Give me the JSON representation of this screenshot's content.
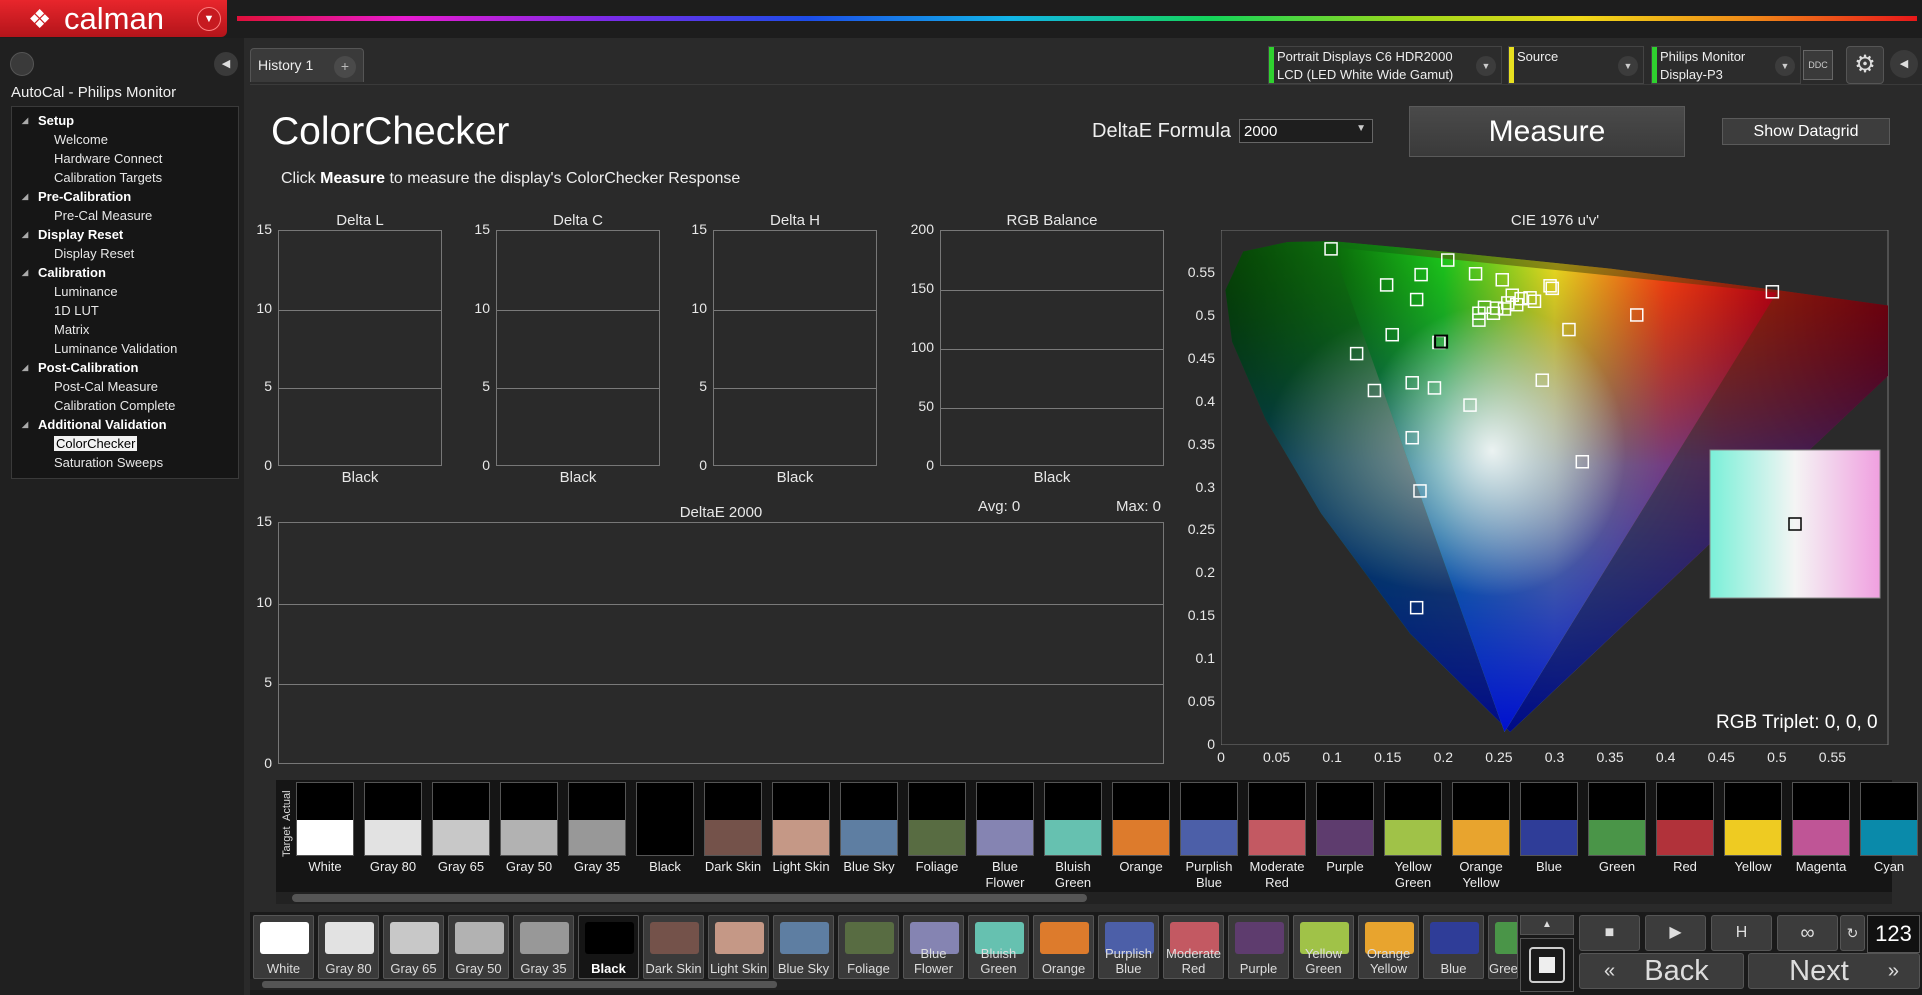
{
  "app": {
    "name": "calman",
    "tab": "History 1",
    "tab_add": "+"
  },
  "devices": {
    "display": {
      "line1": "Portrait Displays C6 HDR2000",
      "line2": "LCD (LED White Wide Gamut)",
      "color": "#2fd22f"
    },
    "source": {
      "line1": "Source",
      "line2": "",
      "color": "#e8e020"
    },
    "monitor": {
      "line1": "Philips Monitor",
      "line2": "Display-P3",
      "color": "#2fd22f"
    },
    "ddc": "DDC"
  },
  "sidebar": {
    "title": "AutoCal - Philips Monitor",
    "sections": [
      {
        "label": "Setup",
        "items": [
          "Welcome",
          "Hardware Connect",
          "Calibration Targets"
        ]
      },
      {
        "label": "Pre-Calibration",
        "items": [
          "Pre-Cal Measure"
        ]
      },
      {
        "label": "Display Reset",
        "items": [
          "Display Reset"
        ]
      },
      {
        "label": "Calibration",
        "items": [
          "Luminance",
          "1D LUT",
          "Matrix",
          "Luminance Validation"
        ]
      },
      {
        "label": "Post-Calibration",
        "items": [
          "Post-Cal Measure",
          "Calibration Complete"
        ]
      },
      {
        "label": "Additional Validation",
        "items": [
          "ColorChecker",
          "Saturation Sweeps"
        ]
      }
    ],
    "selected": "ColorChecker"
  },
  "page": {
    "title": "ColorChecker",
    "subtitle_pre": "Click ",
    "subtitle_bold": "Measure",
    "subtitle_post": " to measure the display's ColorChecker Response",
    "deltae_label": "DeltaE Formula",
    "deltae_value": "2000",
    "measure_button": "Measure",
    "datagrid_button": "Show Datagrid",
    "rgb_triplet": "RGB Triplet: 0, 0, 0"
  },
  "chart_data": [
    {
      "type": "bar",
      "title": "Delta L",
      "categories": [
        "Black"
      ],
      "values": [
        0
      ],
      "ylim": [
        0,
        15
      ],
      "yticks": [
        0,
        5,
        10,
        15
      ]
    },
    {
      "type": "bar",
      "title": "Delta C",
      "categories": [
        "Black"
      ],
      "values": [
        0
      ],
      "ylim": [
        0,
        15
      ],
      "yticks": [
        0,
        5,
        10,
        15
      ]
    },
    {
      "type": "bar",
      "title": "Delta H",
      "categories": [
        "Black"
      ],
      "values": [
        0
      ],
      "ylim": [
        0,
        15
      ],
      "yticks": [
        0,
        5,
        10,
        15
      ]
    },
    {
      "type": "bar",
      "title": "RGB Balance",
      "categories": [
        "Black"
      ],
      "values": [
        0
      ],
      "ylim": [
        0,
        200
      ],
      "yticks": [
        0,
        50,
        100,
        150,
        200
      ]
    },
    {
      "type": "bar",
      "title": "DeltaE 2000",
      "avg": "Avg: 0",
      "max": "Max: 0",
      "values": [],
      "ylim": [
        0,
        15
      ],
      "yticks": [
        0,
        5,
        10,
        15
      ]
    },
    {
      "type": "scatter",
      "title": "CIE 1976 u'v'",
      "xlim": [
        0,
        0.6
      ],
      "ylim": [
        0,
        0.6
      ],
      "xticks": [
        "0",
        "0.05",
        "0.1",
        "0.15",
        "0.2",
        "0.25",
        "0.3",
        "0.35",
        "0.4",
        "0.45",
        "0.5",
        "0.55"
      ],
      "yticks": [
        "0",
        "0.05",
        "0.1",
        "0.15",
        "0.2",
        "0.25",
        "0.3",
        "0.35",
        "0.4",
        "0.45",
        "0.5",
        "0.55"
      ],
      "gamut_triangle": [
        [
          0.1,
          0.58
        ],
        [
          0.5,
          0.527
        ],
        [
          0.255,
          0.015
        ]
      ],
      "targets": [
        [
          0.099,
          0.578
        ],
        [
          0.204,
          0.565
        ],
        [
          0.18,
          0.548
        ],
        [
          0.229,
          0.549
        ],
        [
          0.253,
          0.542
        ],
        [
          0.149,
          0.536
        ],
        [
          0.296,
          0.535
        ],
        [
          0.298,
          0.532
        ],
        [
          0.262,
          0.524
        ],
        [
          0.27,
          0.52
        ],
        [
          0.278,
          0.521
        ],
        [
          0.258,
          0.515
        ],
        [
          0.248,
          0.509
        ],
        [
          0.266,
          0.513
        ],
        [
          0.282,
          0.517
        ],
        [
          0.255,
          0.508
        ],
        [
          0.237,
          0.51
        ],
        [
          0.245,
          0.503
        ],
        [
          0.232,
          0.503
        ],
        [
          0.232,
          0.495
        ],
        [
          0.176,
          0.519
        ],
        [
          0.374,
          0.501
        ],
        [
          0.496,
          0.528
        ],
        [
          0.313,
          0.484
        ],
        [
          0.154,
          0.478
        ],
        [
          0.196,
          0.469
        ],
        [
          0.122,
          0.456
        ],
        [
          0.138,
          0.413
        ],
        [
          0.172,
          0.422
        ],
        [
          0.192,
          0.416
        ],
        [
          0.224,
          0.396
        ],
        [
          0.289,
          0.425
        ],
        [
          0.172,
          0.358
        ],
        [
          0.325,
          0.33
        ],
        [
          0.179,
          0.296
        ],
        [
          0.176,
          0.16
        ]
      ],
      "measured": [
        [
          0.198,
          0.47
        ]
      ]
    }
  ],
  "swatches": [
    {
      "label": "White",
      "color": "#ffffff"
    },
    {
      "label": "Gray 80",
      "color": "#e2e2e2"
    },
    {
      "label": "Gray 65",
      "color": "#c8c8c8"
    },
    {
      "label": "Gray 50",
      "color": "#b2b2b2"
    },
    {
      "label": "Gray 35",
      "color": "#989898"
    },
    {
      "label": "Black",
      "color": "#000000"
    },
    {
      "label": "Dark Skin",
      "color": "#74524a"
    },
    {
      "label": "Light Skin",
      "color": "#c59886"
    },
    {
      "label": "Blue Sky",
      "color": "#5e7ea2"
    },
    {
      "label": "Foliage",
      "color": "#586c42"
    },
    {
      "label": "Blue Flower",
      "color": "#8584b2"
    },
    {
      "label": "Bluish Green",
      "color": "#66c1b0"
    },
    {
      "label": "Orange",
      "color": "#dd7b2c"
    },
    {
      "label": "Purplish Blue",
      "color": "#4c5fa8"
    },
    {
      "label": "Moderate Red",
      "color": "#c35962"
    },
    {
      "label": "Purple",
      "color": "#5e3c6e"
    },
    {
      "label": "Yellow Green",
      "color": "#a0c248"
    },
    {
      "label": "Orange Yellow",
      "color": "#e8a42e"
    },
    {
      "label": "Blue",
      "color": "#2f3d98"
    },
    {
      "label": "Green",
      "color": "#4a9548"
    },
    {
      "label": "Red",
      "color": "#b1323a"
    },
    {
      "label": "Yellow",
      "color": "#eecb22"
    },
    {
      "label": "Magenta",
      "color": "#bf5596"
    },
    {
      "label": "Cyan",
      "color": "#0a8aaa"
    }
  ],
  "swatch_side_labels": {
    "actual": "Actual",
    "target": "Target"
  },
  "bottom_selected": "Black",
  "bottom_visible": [
    "White",
    "Gray 80",
    "Gray 65",
    "Gray 50",
    "Gray 35",
    "Black",
    "Dark Skin",
    "Light Skin",
    "Blue Sky",
    "Foliage",
    "Blue Flower",
    "Bluish Green",
    "Orange",
    "Purplish Blue",
    "Moderate Red",
    "Purple",
    "Yellow Green",
    "Orange Yellow",
    "Blue",
    "Green"
  ],
  "controls": {
    "back": "Back",
    "next": "Next",
    "counter": "123"
  }
}
